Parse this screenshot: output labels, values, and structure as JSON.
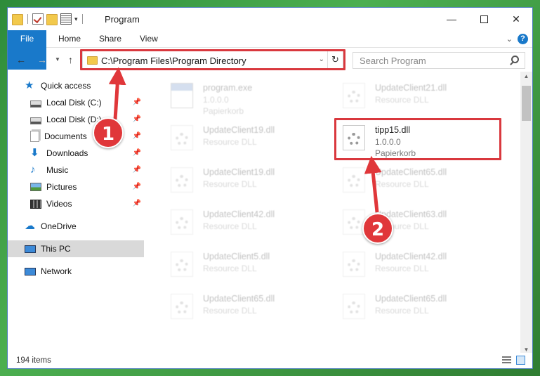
{
  "window": {
    "title": "Program"
  },
  "ribbon": {
    "tabs": [
      "File",
      "Home",
      "Share",
      "View"
    ],
    "help": "?"
  },
  "nav": {
    "address": "C:\\Program Files\\Program Directory",
    "search_placeholder": "Search Program"
  },
  "sidebar": {
    "items": [
      {
        "label": "Quick access"
      },
      {
        "label": "Local Disk (C:)"
      },
      {
        "label": "Local Disk (D:)"
      },
      {
        "label": "Documents"
      },
      {
        "label": "Downloads"
      },
      {
        "label": "Music"
      },
      {
        "label": "Pictures"
      },
      {
        "label": "Videos"
      },
      {
        "label": "OneDrive"
      },
      {
        "label": "This PC"
      },
      {
        "label": "Network"
      }
    ]
  },
  "files": [
    {
      "name": "program.exe",
      "line2": "1.0.0.0",
      "line3": "Papierkorb"
    },
    {
      "name": "UpdateClient21.dll",
      "line2": "Resource DLL"
    },
    {
      "name": "UpdateClient19.dll",
      "line2": "Resource DLL"
    },
    {
      "name": "tipp15.dll",
      "line2": "1.0.0.0",
      "line3": "Papierkorb"
    },
    {
      "name": "UpdateClient19.dll",
      "line2": "Resource DLL"
    },
    {
      "name": "UpdateClient65.dll",
      "line2": "Resource DLL"
    },
    {
      "name": "UpdateClient42.dll",
      "line2": "Resource DLL"
    },
    {
      "name": "UpdateClient63.dll",
      "line2": "Resource DLL"
    },
    {
      "name": "UpdateClient5.dll",
      "line2": "Resource DLL"
    },
    {
      "name": "UpdateClient42.dll",
      "line2": "Resource DLL"
    },
    {
      "name": "UpdateClient65.dll",
      "line2": "Resource DLL"
    },
    {
      "name": "UpdateClient65.dll",
      "line2": "Resource DLL"
    }
  ],
  "status": {
    "count": "194 items"
  },
  "annotations": {
    "step1": "1",
    "step2": "2",
    "color": "#d9383e"
  }
}
